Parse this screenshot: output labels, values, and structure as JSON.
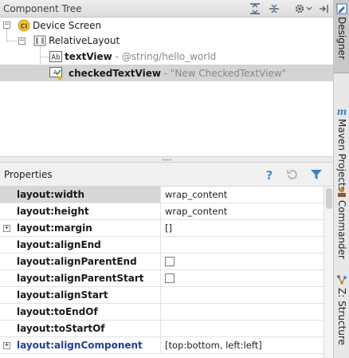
{
  "component_tree": {
    "title": "Component Tree",
    "nodes": [
      {
        "label": "Device Screen",
        "hint": "",
        "icon": "device-screen-icon"
      },
      {
        "label": "RelativeLayout",
        "hint": "",
        "icon": "relative-layout-icon"
      },
      {
        "label": "textView",
        "hint": "- @string/hello_world",
        "icon": "textview-icon"
      },
      {
        "label": "checkedTextView",
        "hint": "- \"New CheckedTextView\"",
        "icon": "checked-textview-icon"
      }
    ]
  },
  "properties": {
    "title": "Properties",
    "rows": [
      {
        "name": "layout:width",
        "value": "wrap_content"
      },
      {
        "name": "layout:height",
        "value": "wrap_content"
      },
      {
        "name": "layout:margin",
        "value": "[]",
        "expandable": "+"
      },
      {
        "name": "layout:alignEnd",
        "value": ""
      },
      {
        "name": "layout:alignParentEnd",
        "value": ""
      },
      {
        "name": "layout:alignParentStart",
        "value": ""
      },
      {
        "name": "layout:alignStart",
        "value": ""
      },
      {
        "name": "layout:toEndOf",
        "value": ""
      },
      {
        "name": "layout:toStartOf",
        "value": ""
      },
      {
        "name": "layout:alignComponent",
        "value": "[top:bottom, left:left]",
        "expandable": "+"
      }
    ]
  },
  "side_tabs": {
    "designer": "Designer",
    "maven": "Maven Projects",
    "commander": "Commander",
    "structure": "Z: Structure"
  },
  "colors": {
    "selection": "#d4d4d4",
    "link_blue": "#1f3f9a",
    "filter_blue": "#3b7fc4",
    "help_blue": "#4a8fd4"
  }
}
